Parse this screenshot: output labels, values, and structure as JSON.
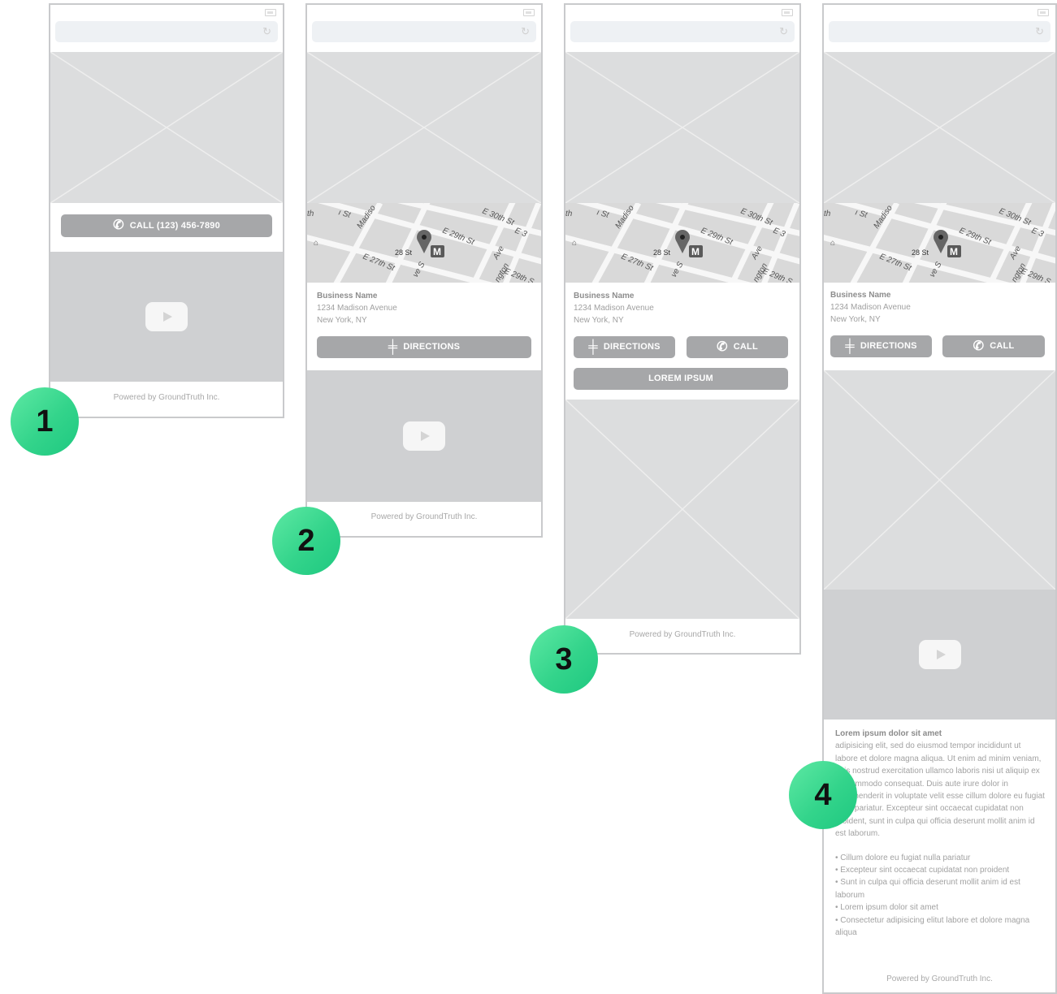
{
  "steps": [
    {
      "badge": "1",
      "call_button": "CALL (123) 456-7890",
      "footer": "Powered by GroundTruth Inc."
    },
    {
      "badge": "2",
      "business": {
        "name": "Business Name",
        "street": "1234 Madison Avenue",
        "city": "New York, NY"
      },
      "directions_button": "DIRECTIONS",
      "footer": "Powered by GroundTruth Inc."
    },
    {
      "badge": "3",
      "business": {
        "name": "Business Name",
        "street": "1234 Madison Avenue",
        "city": "New York, NY"
      },
      "directions_button": "DIRECTIONS",
      "call_button": "CALL",
      "lorem_button": "LOREM IPSUM",
      "footer": "Powered by GroundTruth Inc."
    },
    {
      "badge": "4",
      "business": {
        "name": "Business Name",
        "street": "1234 Madison Avenue",
        "city": "New York, NY"
      },
      "directions_button": "DIRECTIONS",
      "call_button": "CALL",
      "text_heading": "Lorem ipsum dolor sit amet",
      "text_body": "adipisicing elit, sed do eiusmod tempor incididunt ut labore et dolore magna aliqua. Ut enim ad minim veniam, quis nostrud exercitation ullamco laboris nisi ut aliquip ex ea commodo consequat. Duis aute irure dolor in reprehenderit in voluptate velit esse cillum dolore eu fugiat nulla pariatur. Excepteur sint occaecat cupidatat non proident, sunt in culpa qui officia deserunt mollit anim id est laborum.",
      "bullets": [
        "• Cillum dolore eu fugiat nulla pariatur",
        "• Excepteur sint occaecat cupidatat non proident",
        "• Sunt in culpa qui officia deserunt mollit anim id est laborum",
        "• Lorem ipsum dolor sit amet",
        "• Consectetur adipisicing elitut labore et dolore magna aliqua"
      ],
      "footer": "Powered by GroundTruth Inc."
    }
  ],
  "map_labels": {
    "st_30": "E 30th St",
    "st_29": "E 29th St",
    "st_29b": "E 29th S",
    "st_27": "E 27th St",
    "st_28": "28 St",
    "madison": "Madiso",
    "ave": "Ave",
    "lington": "ngton",
    "wst": "ı St",
    "th": "th",
    "ves": "ve S",
    "e3": "E 3",
    "metro": "M"
  },
  "icons": {
    "phone": "phone-icon",
    "signpost": "signpost-icon",
    "play": "play-icon",
    "pin": "map-pin-icon"
  },
  "colors": {
    "badge_start": "#5ee9a4",
    "badge_end": "#1ec880",
    "button": "#a6a7a9",
    "placeholder": "#dcddde"
  }
}
